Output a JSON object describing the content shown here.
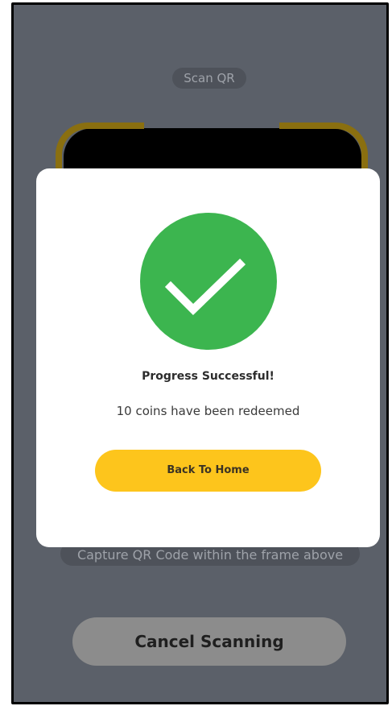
{
  "scanner": {
    "title": "Scan QR",
    "hint": "Capture QR Code within the frame above",
    "cancel_label": "Cancel Scanning"
  },
  "dialog": {
    "icon": "check-circle-icon",
    "title": "Progress Successful!",
    "message": "10 coins have been redeemed",
    "button_label": "Back To Home"
  },
  "colors": {
    "overlay": "#5b6069",
    "success_green": "#3cb54f",
    "accent_yellow": "#fdc51c",
    "frame_corner": "#8a6f10",
    "cancel_button": "#8c8c8c"
  }
}
